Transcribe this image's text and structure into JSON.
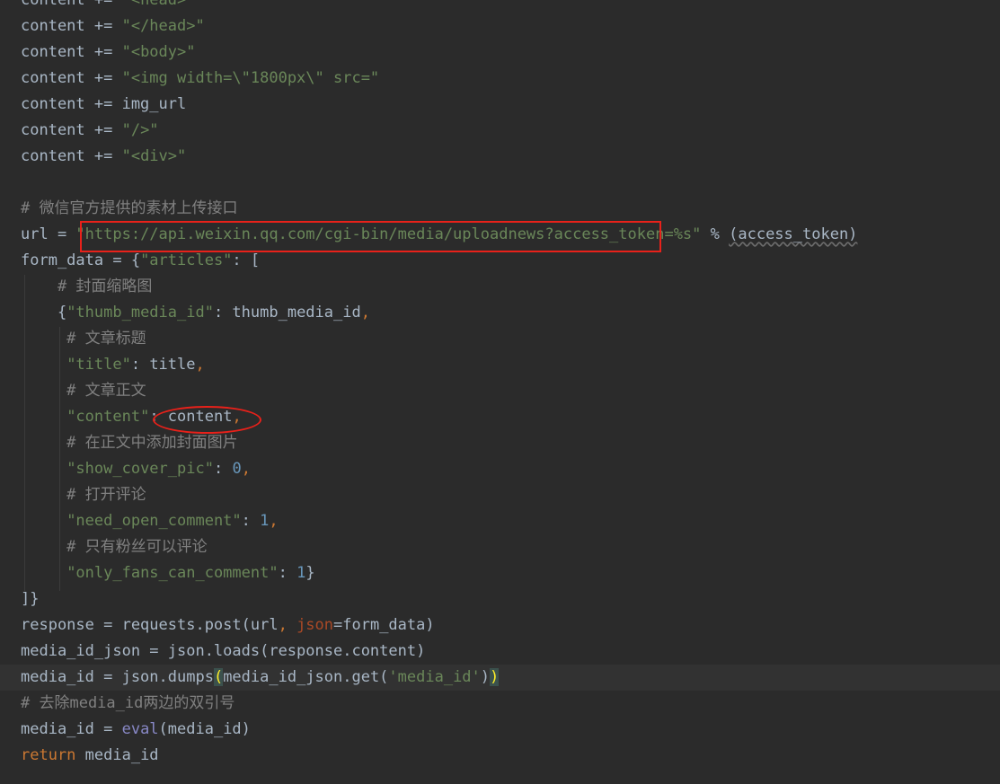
{
  "editor": {
    "lines": [
      [
        [
          "plain",
          "content += "
        ],
        [
          "string",
          "\"<head>\""
        ]
      ],
      [
        [
          "plain",
          "content += "
        ],
        [
          "string",
          "\"</head>\""
        ]
      ],
      [
        [
          "plain",
          "content += "
        ],
        [
          "string",
          "\"<body>\""
        ]
      ],
      [
        [
          "plain",
          "content += "
        ],
        [
          "string",
          "\"<img width=\\\"1800px\\\" src=\""
        ]
      ],
      [
        [
          "plain",
          "content += img_url"
        ]
      ],
      [
        [
          "plain",
          "content += "
        ],
        [
          "string",
          "\"/>\""
        ]
      ],
      [
        [
          "plain",
          "content += "
        ],
        [
          "string",
          "\"<div>\""
        ]
      ],
      [],
      [
        [
          "comment",
          "# 微信官方提供的素材上传接口"
        ]
      ],
      [
        [
          "plain",
          "url = "
        ],
        [
          "string",
          "\"https://api.weixin.qq.com/cgi-bin/media/uploadnews?access_token=%s\""
        ],
        [
          "plain",
          " % "
        ],
        [
          "squiggle",
          "(access_token)"
        ]
      ],
      [
        [
          "plain",
          "form_data = {"
        ],
        [
          "string",
          "\"articles\""
        ],
        [
          "plain",
          ": ["
        ]
      ],
      [
        [
          "comment",
          "    # 封面缩略图"
        ]
      ],
      [
        [
          "plain",
          "    {"
        ],
        [
          "string",
          "\"thumb_media_id\""
        ],
        [
          "plain",
          ": thumb_media_id"
        ],
        [
          "keyword",
          ","
        ]
      ],
      [
        [
          "comment",
          "     # 文章标题"
        ]
      ],
      [
        [
          "plain",
          "     "
        ],
        [
          "string",
          "\"title\""
        ],
        [
          "plain",
          ": title"
        ],
        [
          "keyword",
          ","
        ]
      ],
      [
        [
          "comment",
          "     # 文章正文"
        ]
      ],
      [
        [
          "plain",
          "     "
        ],
        [
          "string",
          "\"content\""
        ],
        [
          "plain",
          ": content"
        ],
        [
          "keyword",
          ","
        ]
      ],
      [
        [
          "comment",
          "     # 在正文中添加封面图片"
        ]
      ],
      [
        [
          "plain",
          "     "
        ],
        [
          "string",
          "\"show_cover_pic\""
        ],
        [
          "plain",
          ": "
        ],
        [
          "number",
          "0"
        ],
        [
          "keyword",
          ","
        ]
      ],
      [
        [
          "comment",
          "     # 打开评论"
        ]
      ],
      [
        [
          "plain",
          "     "
        ],
        [
          "string",
          "\"need_open_comment\""
        ],
        [
          "plain",
          ": "
        ],
        [
          "number",
          "1"
        ],
        [
          "keyword",
          ","
        ]
      ],
      [
        [
          "comment",
          "     # 只有粉丝可以评论"
        ]
      ],
      [
        [
          "plain",
          "     "
        ],
        [
          "string",
          "\"only_fans_can_comment\""
        ],
        [
          "plain",
          ": "
        ],
        [
          "number",
          "1"
        ],
        [
          "plain",
          "}"
        ]
      ],
      [
        [
          "plain",
          "]}"
        ]
      ],
      [
        [
          "plain",
          "response = requests.post(url"
        ],
        [
          "keyword",
          ", "
        ],
        [
          "kwarg",
          "json"
        ],
        [
          "plain",
          "=form_data)"
        ]
      ],
      [
        [
          "plain",
          "media_id_json = json.loads(response.content)"
        ]
      ],
      [
        [
          "plain",
          "media_id = json.dumps"
        ],
        [
          "bracket-match",
          "("
        ],
        [
          "plain",
          "media_id_json.get("
        ],
        [
          "string",
          "'media_id'"
        ],
        [
          "plain",
          ")"
        ],
        [
          "bracket-match",
          ")"
        ]
      ],
      [
        [
          "comment",
          "# 去除media_id两边的双引号"
        ]
      ],
      [
        [
          "plain",
          "media_id = "
        ],
        [
          "builtin",
          "eval"
        ],
        [
          "plain",
          "(media_id)"
        ]
      ],
      [
        [
          "keyword",
          "return"
        ],
        [
          "plain",
          " media_id"
        ]
      ]
    ],
    "current_line": 26
  },
  "annotations": {
    "url_box_color": "#e8211a",
    "content_oval_color": "#e8211a"
  },
  "colors": {
    "background": "#2b2b2b",
    "current_line": "#323232",
    "plain": "#a9b7c6",
    "string": "#6a8759",
    "comment": "#808080",
    "number": "#6897bb",
    "keyword": "#cc7832",
    "kwarg": "#aa4926",
    "builtin": "#8888c6",
    "bracket_match": "#ffef28"
  }
}
